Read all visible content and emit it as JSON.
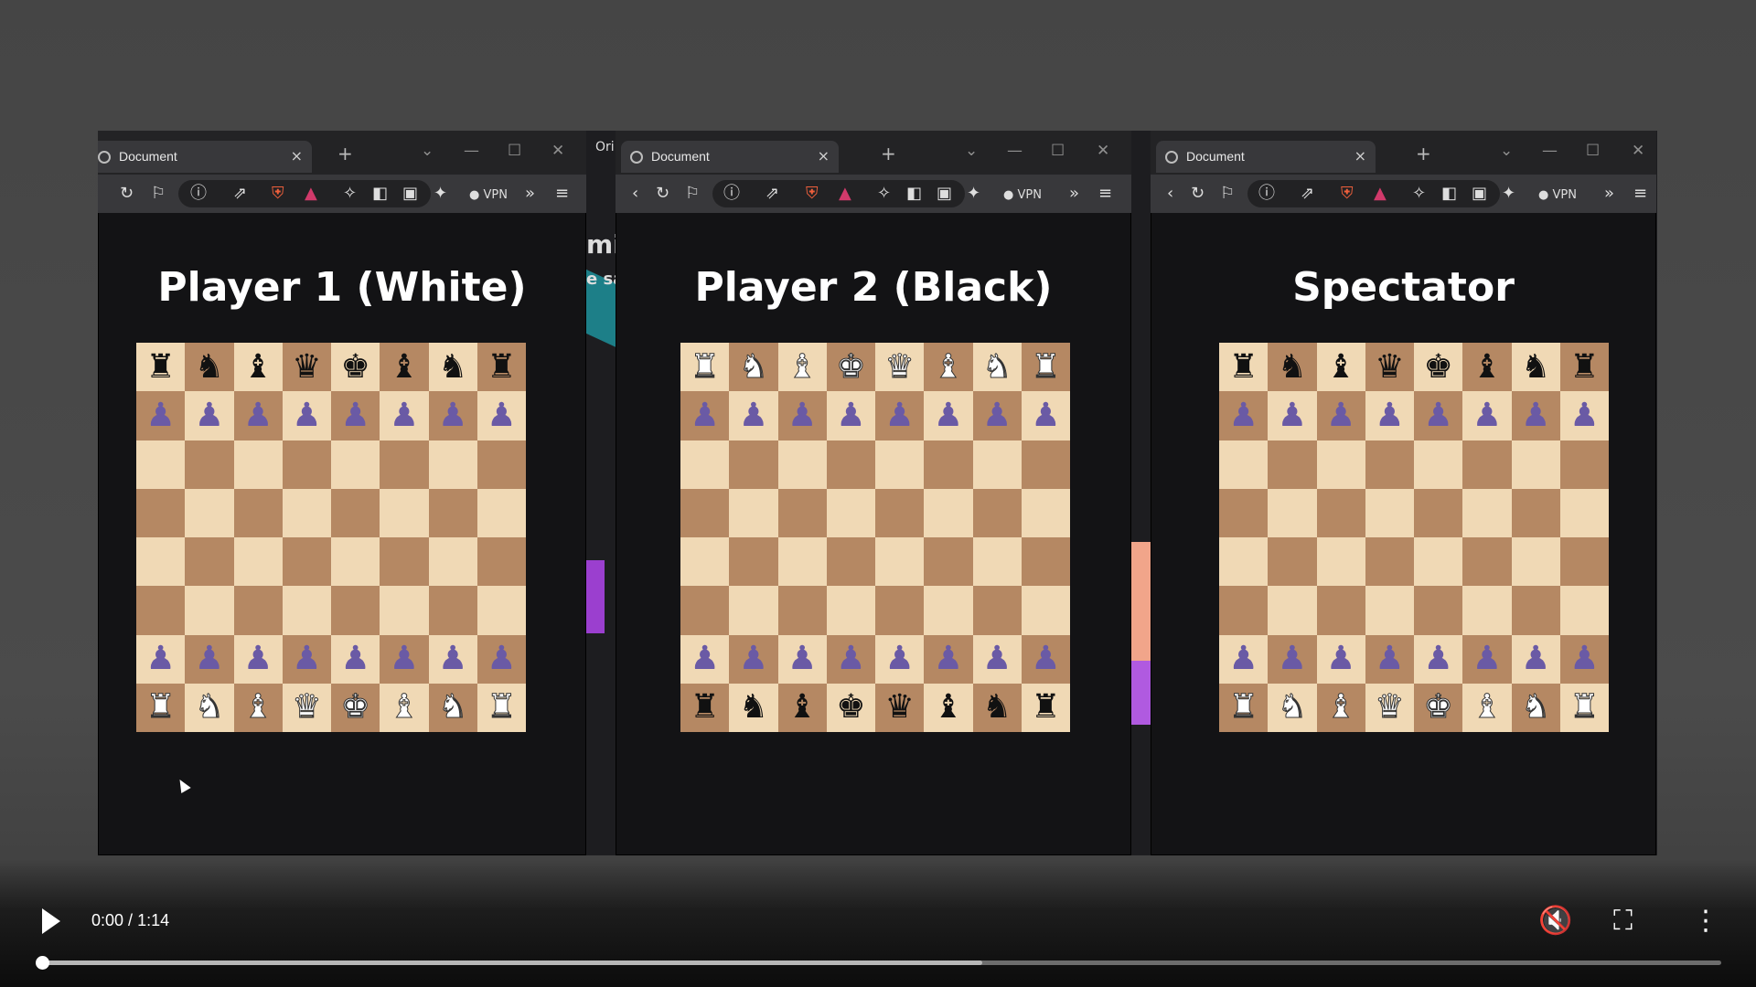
{
  "player": {
    "time_current": "0:00",
    "time_total": "1:14",
    "time_sep": " / ",
    "buffered_fraction": 0.56,
    "played_fraction": 0.0,
    "icons": [
      "play-icon",
      "mute-icon",
      "exit-fullscreen-icon",
      "more-vert-icon"
    ]
  },
  "background_text": {
    "frag1": "Ori",
    "frag2": "mir",
    "frag3": "e sa"
  },
  "browser": {
    "tab_label": "Document",
    "tab_close": "×",
    "new_tab": "+",
    "vpn_label": "VPN",
    "accent_shield": "#f0603c",
    "accent_triangle": "#d13a6b"
  },
  "windows": [
    {
      "title": "Player 1 (White)"
    },
    {
      "title": "Player 2 (Black)"
    },
    {
      "title": "Spectator"
    }
  ],
  "boards": {
    "player1": [
      "rnbqkbnr",
      "pppppppp",
      "........",
      "........",
      "........",
      "........",
      "pppppppp",
      "RNBQKBNR"
    ],
    "player2": [
      "RNBKQBNR",
      "pppppppp",
      "........",
      "........",
      "........",
      "........",
      "pppppppp",
      "rnbkqbnr"
    ],
    "spectator": [
      "rnbqkbnr",
      "pppppppp",
      "........",
      "........",
      "........",
      "........",
      "pppppppp",
      "RNBQKBNR"
    ]
  },
  "colors": {
    "light_square": "#f0d9b5",
    "dark_square": "#b58863",
    "pawn": "#6a5aa5"
  }
}
